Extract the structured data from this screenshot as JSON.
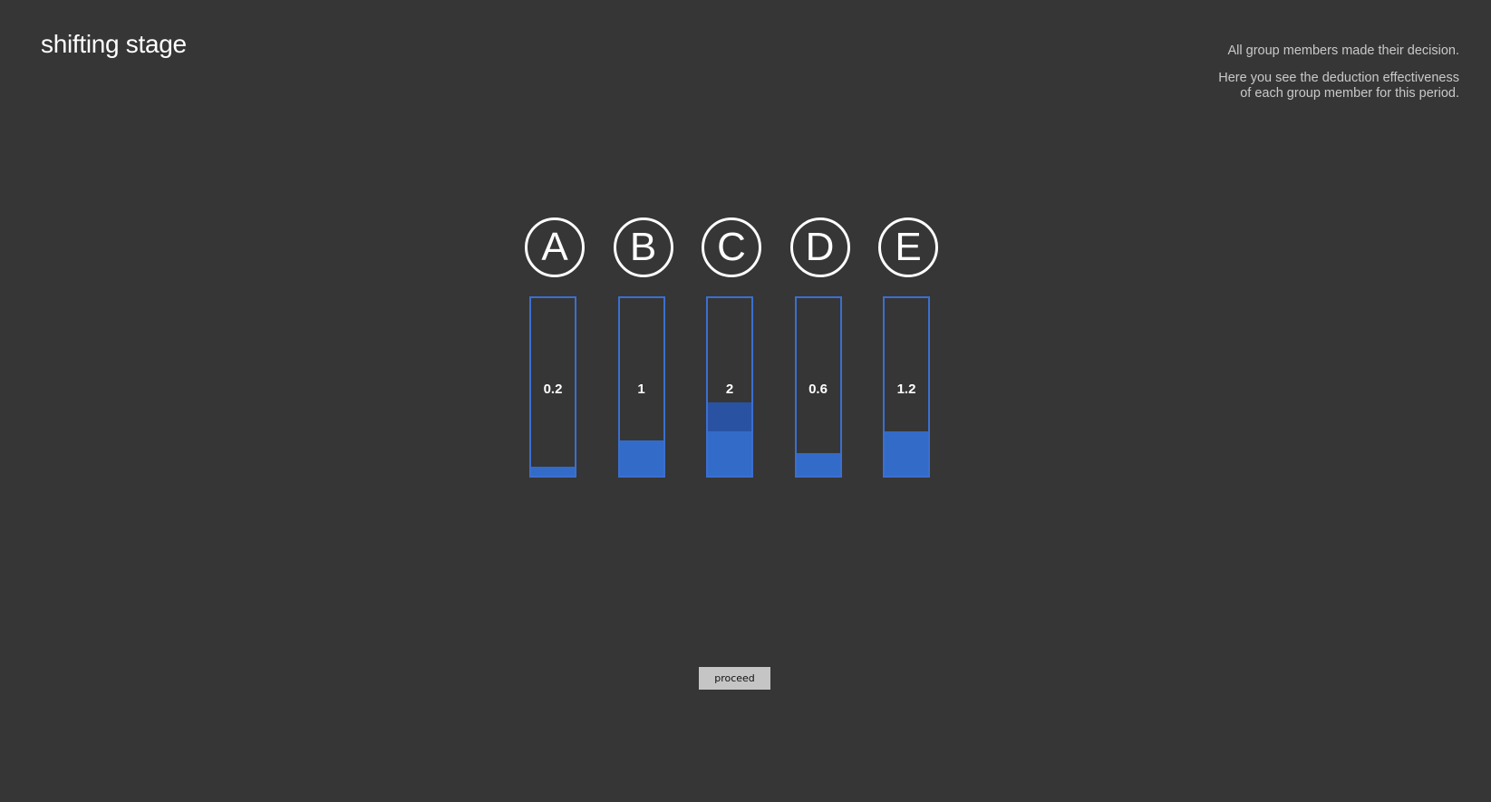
{
  "header": {
    "title": "shifting stage"
  },
  "info": {
    "line1": "All group members made their decision.",
    "line2": "Here you see the deduction effectiveness",
    "line3": "of each group member for this period."
  },
  "colors": {
    "background": "#363636",
    "bar_border": "#3b6fd0",
    "bar_fill": "#336bc8",
    "bar_extra": "#2a52a3",
    "button": "#c5c5c5"
  },
  "scale_max": 4,
  "members": [
    {
      "letter": "A",
      "value": "0.2",
      "amount": 0.2,
      "extra": 0
    },
    {
      "letter": "B",
      "value": "1",
      "amount": 0.8,
      "extra": 0
    },
    {
      "letter": "C",
      "value": "2",
      "amount": 1.0,
      "extra": 0.65
    },
    {
      "letter": "D",
      "value": "0.6",
      "amount": 0.5,
      "extra": 0
    },
    {
      "letter": "E",
      "value": "1.2",
      "amount": 1.0,
      "extra": 0
    }
  ],
  "footer": {
    "proceed_label": "proceed"
  }
}
